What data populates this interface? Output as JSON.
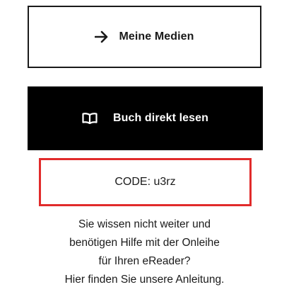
{
  "buttons": {
    "my_media": {
      "label": "Meine Medien",
      "icon": "arrow-right-icon"
    },
    "read_book": {
      "label": "Buch direkt lesen",
      "icon": "open-book-icon"
    }
  },
  "code": {
    "text": "CODE: u3rz",
    "highlight_color": "#e12b2b"
  },
  "help": {
    "lines": [
      "Sie wissen nicht weiter und",
      "benötigen Hilfe mit der Onleihe",
      "für Ihren eReader?",
      "Hier finden Sie unsere Anleitung."
    ]
  }
}
